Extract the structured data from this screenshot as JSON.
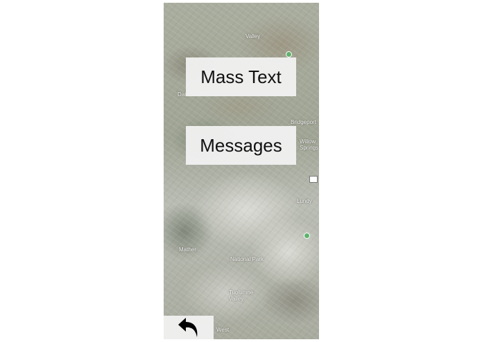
{
  "map": {
    "labels": [
      "Valley",
      "Dar",
      "Bridgeport",
      "Willow Springs",
      "Lundy",
      "Mather",
      "National Park",
      "Tuolumne Valley",
      "West"
    ]
  },
  "menu": {
    "mass_text_label": "Mass Text",
    "messages_label": "Messages"
  },
  "navigation": {
    "back_icon": "back-arrow-icon"
  },
  "colors": {
    "button_bg": "#f0f0f0",
    "button_text": "#111111",
    "map_pin": "#5fb36c"
  }
}
